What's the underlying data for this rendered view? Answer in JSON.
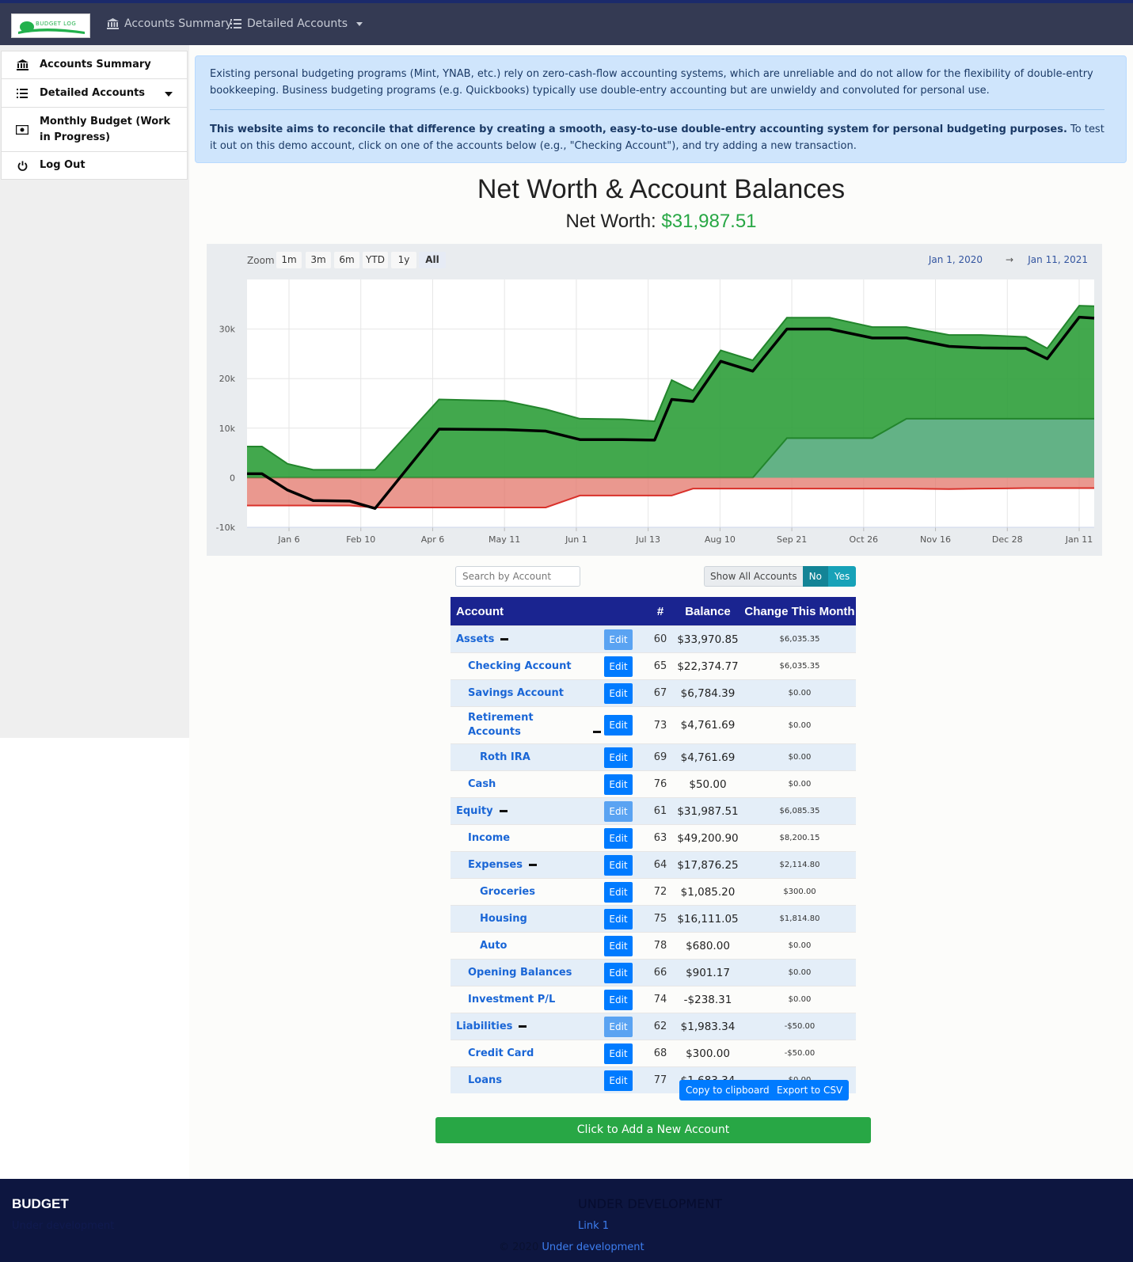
{
  "navbar": {
    "logo_text": "BUDGET LOG",
    "items": [
      {
        "label": "Accounts Summary",
        "icon": "bank-icon"
      },
      {
        "label": "Detailed Accounts",
        "icon": "list-icon"
      }
    ]
  },
  "sidebar": {
    "items": [
      {
        "label": "Accounts Summary",
        "icon": "bank-icon"
      },
      {
        "label": "Detailed Accounts",
        "icon": "list-icon"
      },
      {
        "label": "Monthly Budget (Work in Progress)",
        "icon": "money-icon"
      },
      {
        "label": "Log Out",
        "icon": "power-icon"
      }
    ]
  },
  "info": {
    "paragraph1": "Existing personal budgeting programs (Mint, YNAB, etc.) rely on zero-cash-flow accounting systems, which are unreliable and do not allow for the flexibility of double-entry bookkeeping. Business budgeting programs (e.g. Quickbooks) typically use double-entry accounting but are unwieldy and convoluted for personal use.",
    "paragraph2_bold": "This website aims to reconcile that difference by creating a smooth, easy-to-use double-entry accounting system for personal budgeting purposes.",
    "paragraph2_rest": " To test it out on this demo account, click on one of the accounts below (e.g., \"Checking Account\"), and try adding a new transaction."
  },
  "page": {
    "title": "Net Worth & Account Balances",
    "net_worth_label": "Net Worth: ",
    "net_worth_value": "$31,987.51"
  },
  "chart_controls": {
    "zoom_label": "Zoom",
    "zoom_options": [
      "1m",
      "3m",
      "6m",
      "YTD",
      "1y",
      "All"
    ],
    "selected_zoom": "All",
    "range_from": "Jan 1, 2020",
    "range_arrow": "→",
    "range_to": "Jan 11, 2021"
  },
  "chart_data": {
    "type": "area",
    "title": "",
    "xlabel": "",
    "ylabel": "",
    "ylim": [
      -10000,
      40000
    ],
    "grid": true,
    "x_tick_labels": [
      "Jan 6",
      "Feb 10",
      "Apr 6",
      "May 11",
      "Jun 1",
      "Jul 13",
      "Aug 10",
      "Sep 21",
      "Oct 26",
      "Nov 16",
      "Dec 28",
      "Jan 11"
    ],
    "y_tick_labels": [
      "-10k",
      "0",
      "10k",
      "20k",
      "30k"
    ],
    "y_ticks": [
      -10000,
      0,
      10000,
      20000,
      30000
    ],
    "x": [
      "2020-01-01",
      "2020-01-08",
      "2020-01-20",
      "2020-02-01",
      "2020-02-18",
      "2020-03-01",
      "2020-03-31",
      "2020-05-01",
      "2020-05-20",
      "2020-06-05",
      "2020-06-25",
      "2020-07-10",
      "2020-07-18",
      "2020-07-28",
      "2020-08-10",
      "2020-08-25",
      "2020-09-10",
      "2020-09-30",
      "2020-10-20",
      "2020-11-05",
      "2020-11-25",
      "2020-12-10",
      "2020-12-31",
      "2021-01-10",
      "2021-01-25",
      "2021-02-01"
    ],
    "series": [
      {
        "color": "#2e9e3a",
        "values": [
          6300,
          6300,
          2800,
          1600,
          1600,
          1600,
          15800,
          15500,
          13800,
          11900,
          11800,
          11400,
          19700,
          17600,
          25700,
          23700,
          32300,
          32300,
          30400,
          30400,
          28800,
          28800,
          28400,
          26100,
          34700,
          34600
        ]
      },
      {
        "color": "#6fb59a",
        "values": [
          0,
          0,
          0,
          0,
          0,
          0,
          0,
          0,
          0,
          0,
          0,
          0,
          0,
          0,
          0,
          0,
          8000,
          8000,
          8000,
          11900,
          11900,
          11900,
          11900,
          11900,
          11900,
          11900
        ]
      },
      {
        "color": "#e3756a",
        "values": [
          -5600,
          -5600,
          -5600,
          -5600,
          -5600,
          -6000,
          -6000,
          -6000,
          -6000,
          -3600,
          -3600,
          -3600,
          -3600,
          -2200,
          -2200,
          -2200,
          -2200,
          -2200,
          -2200,
          -2200,
          -2300,
          -2200,
          -2100,
          -2100,
          -2100,
          -2100
        ]
      },
      {
        "color": "#000000",
        "values": [
          800,
          800,
          -2500,
          -4600,
          -4700,
          -6200,
          9800,
          9700,
          9400,
          7700,
          7700,
          7600,
          15800,
          15400,
          23500,
          21500,
          30000,
          30000,
          28200,
          28200,
          26500,
          26200,
          26100,
          24000,
          32400,
          32200
        ]
      }
    ]
  },
  "controls": {
    "search_placeholder": "Search by Account",
    "show_all_label": "Show All Accounts",
    "no_label": "No",
    "yes_label": "Yes"
  },
  "table": {
    "headers": [
      "Account",
      "#",
      "Balance",
      "Change This Month"
    ],
    "edit_label": "Edit",
    "rows": [
      {
        "name": "Assets",
        "level": 0,
        "collapse": true,
        "num": "60",
        "balance": "$33,970.85",
        "change": "$6,035.35",
        "faded": true
      },
      {
        "name": "Checking Account",
        "level": 1,
        "collapse": false,
        "num": "65",
        "balance": "$22,374.77",
        "change": "$6,035.35",
        "faded": false
      },
      {
        "name": "Savings Account",
        "level": 1,
        "collapse": false,
        "num": "67",
        "balance": "$6,784.39",
        "change": "$0.00",
        "faded": false
      },
      {
        "name": "Retirement Accounts",
        "level": 1,
        "collapse": true,
        "num": "73",
        "balance": "$4,761.69",
        "change": "$0.00",
        "faded": false,
        "wrap": true
      },
      {
        "name": "Roth IRA",
        "level": 2,
        "collapse": false,
        "num": "69",
        "balance": "$4,761.69",
        "change": "$0.00",
        "faded": false
      },
      {
        "name": "Cash",
        "level": 1,
        "collapse": false,
        "num": "76",
        "balance": "$50.00",
        "change": "$0.00",
        "faded": false
      },
      {
        "name": "Equity",
        "level": 0,
        "collapse": true,
        "num": "61",
        "balance": "$31,987.51",
        "change": "$6,085.35",
        "faded": true
      },
      {
        "name": "Income",
        "level": 1,
        "collapse": false,
        "num": "63",
        "balance": "$49,200.90",
        "change": "$8,200.15",
        "faded": false
      },
      {
        "name": "Expenses",
        "level": 1,
        "collapse": true,
        "num": "64",
        "balance": "$17,876.25",
        "change": "$2,114.80",
        "faded": false
      },
      {
        "name": "Groceries",
        "level": 2,
        "collapse": false,
        "num": "72",
        "balance": "$1,085.20",
        "change": "$300.00",
        "faded": false
      },
      {
        "name": "Housing",
        "level": 2,
        "collapse": false,
        "num": "75",
        "balance": "$16,111.05",
        "change": "$1,814.80",
        "faded": false
      },
      {
        "name": "Auto",
        "level": 2,
        "collapse": false,
        "num": "78",
        "balance": "$680.00",
        "change": "$0.00",
        "faded": false
      },
      {
        "name": "Opening Balances",
        "level": 1,
        "collapse": false,
        "num": "66",
        "balance": "$901.17",
        "change": "$0.00",
        "faded": false
      },
      {
        "name": "Investment P/L",
        "level": 1,
        "collapse": false,
        "num": "74",
        "balance": "-$238.31",
        "change": "$0.00",
        "faded": false
      },
      {
        "name": "Liabilities",
        "level": 0,
        "collapse": true,
        "num": "62",
        "balance": "$1,983.34",
        "change": "-$50.00",
        "faded": true
      },
      {
        "name": "Credit Card",
        "level": 1,
        "collapse": false,
        "num": "68",
        "balance": "$300.00",
        "change": "-$50.00",
        "faded": false
      },
      {
        "name": "Loans",
        "level": 1,
        "collapse": false,
        "num": "77",
        "balance": "$1,683.34",
        "change": "$0.00",
        "faded": false
      }
    ]
  },
  "buttons": {
    "copy_clipboard": "Copy to clipboard",
    "export_csv": "Export to CSV",
    "add_account": "Click to Add a New Account"
  },
  "footer": {
    "title": "BUDGET",
    "subtitle": "Under development",
    "heading": "UNDER DEVELOPMENT",
    "link1": "Link 1",
    "copyright": "© 2020 ",
    "copyright_link": "Under development"
  }
}
